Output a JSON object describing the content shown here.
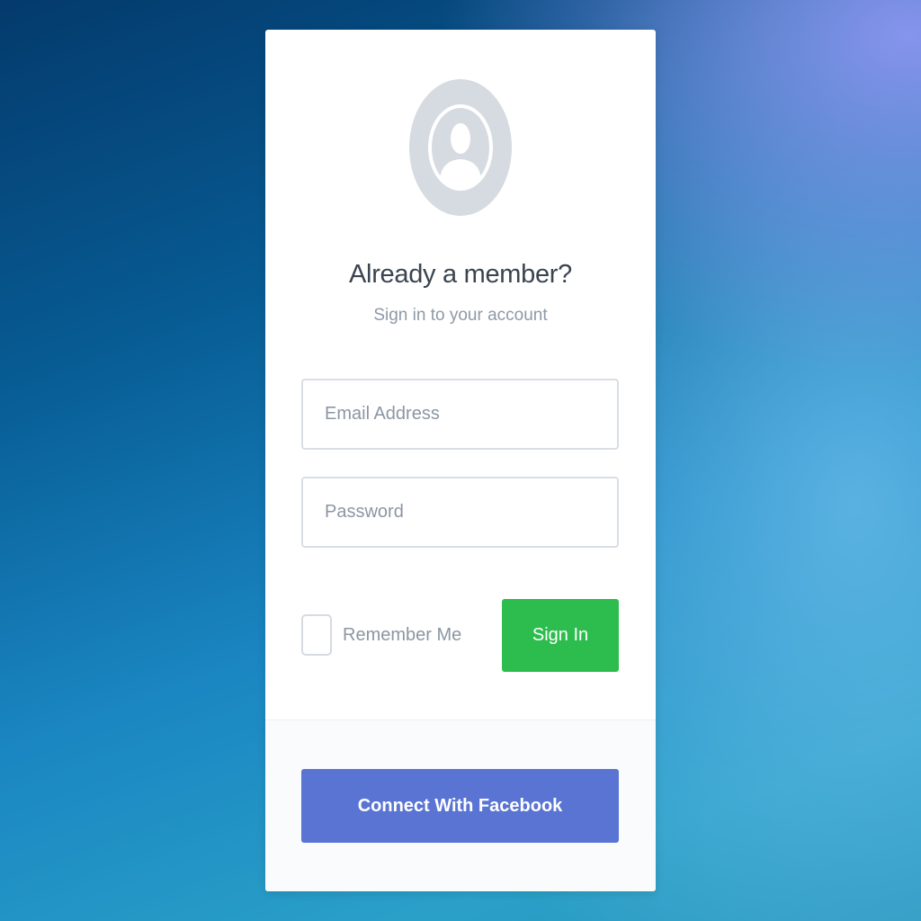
{
  "login": {
    "heading": "Already a member?",
    "subheading": "Sign in to your account",
    "email_placeholder": "Email Address",
    "password_placeholder": "Password",
    "remember_label": "Remember Me",
    "signin_label": "Sign In",
    "facebook_label": "Connect With Facebook",
    "avatar_icon": "user-avatar-icon",
    "remember_checked": false
  },
  "colors": {
    "signin_button": "#2dbd4e",
    "facebook_button": "#5a74d3",
    "avatar_bg": "#d6dbe2",
    "heading_text": "#3a4450",
    "muted_text": "#8c96a3"
  }
}
